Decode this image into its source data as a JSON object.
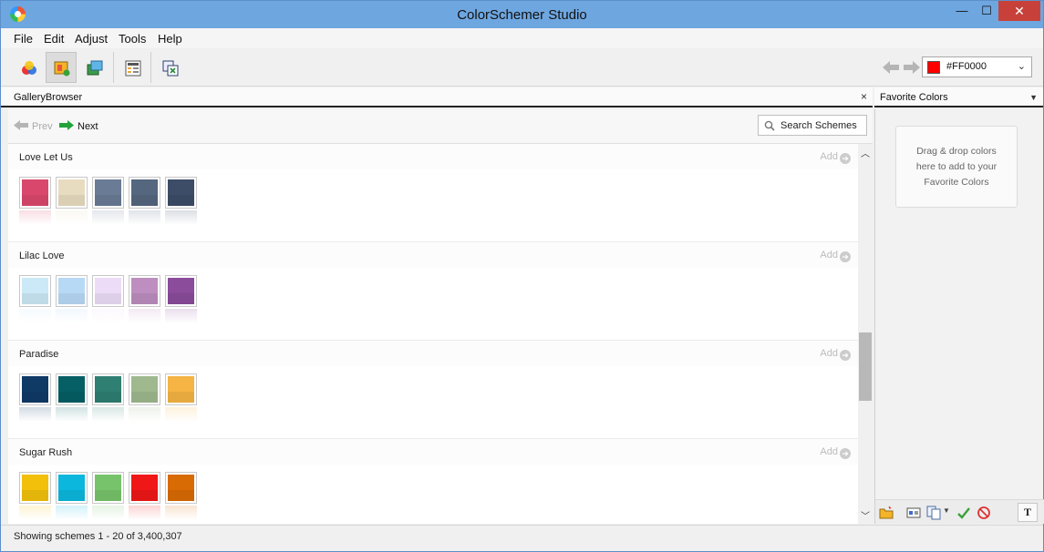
{
  "window": {
    "title": "ColorSchemer Studio",
    "minimize_glyph": "—",
    "maximize_glyph": "☐",
    "close_glyph": "✕"
  },
  "menu": [
    "File",
    "Edit",
    "Adjust",
    "Tools",
    "Help"
  ],
  "toolbar": {
    "buttons": [
      "color-wheel-icon",
      "gallery-icon",
      "schemes-icon",
      "palette-icon",
      "export-icon"
    ],
    "active_index": 1,
    "current_color_label": "#FF0000",
    "current_color_hex": "#FF0000"
  },
  "gallery": {
    "panel_title": "GalleryBrowser",
    "close_glyph": "×",
    "prev_label": "Prev",
    "next_label": "Next",
    "search_label": "Search Schemes",
    "add_label": "Add",
    "schemes": [
      {
        "name": "Love Let Us",
        "colors": [
          "#d9486c",
          "#e8dcc0",
          "#6a7b95",
          "#55667f",
          "#3d4d68"
        ]
      },
      {
        "name": "Lilac Love",
        "colors": [
          "#cbe9f6",
          "#b8d9f6",
          "#ecdcf8",
          "#bd8ebf",
          "#8a4c9b"
        ]
      },
      {
        "name": "Paradise",
        "colors": [
          "#0f3a66",
          "#055f65",
          "#2f7f72",
          "#9fb88e",
          "#f5b444"
        ]
      },
      {
        "name": "Sugar Rush",
        "colors": [
          "#f2c00a",
          "#0bb7dc",
          "#77c36b",
          "#ef1717",
          "#d96b05"
        ]
      }
    ]
  },
  "favorites": {
    "panel_title": "Favorite Colors",
    "drop_line1": "Drag & drop colors",
    "drop_line2": "here to add to your",
    "drop_line3": "Favorite Colors"
  },
  "status": {
    "text": "Showing schemes 1 - 20 of 3,400,307"
  }
}
